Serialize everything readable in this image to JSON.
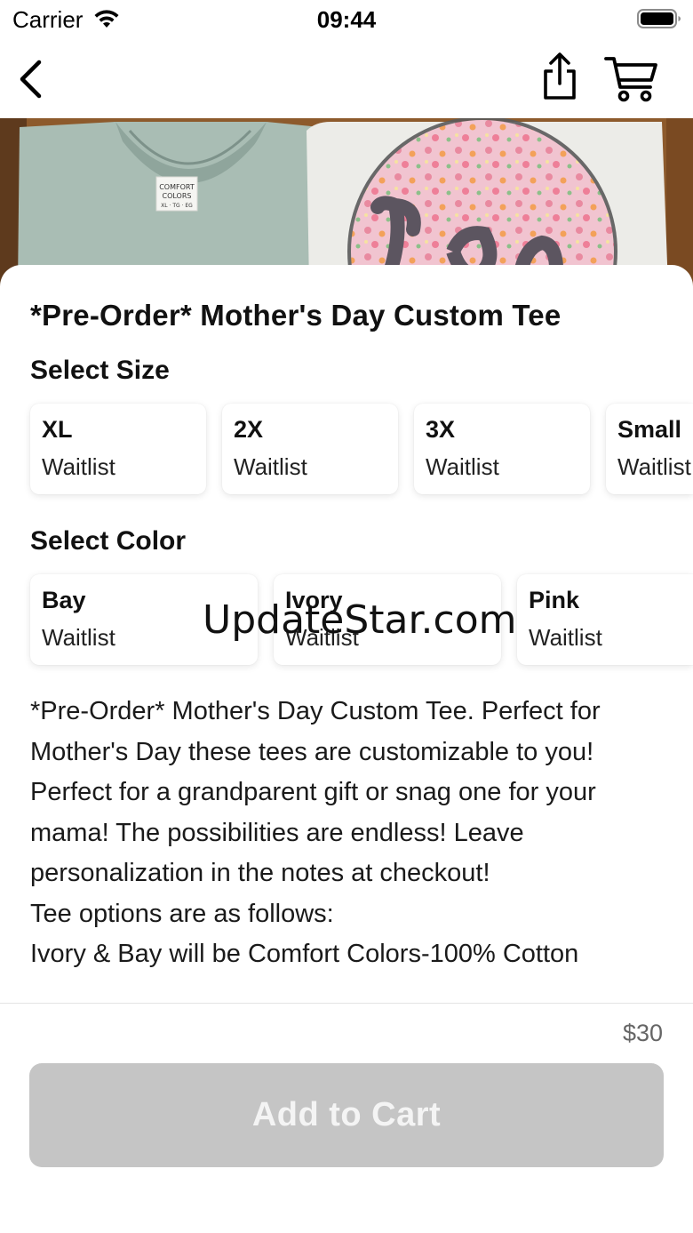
{
  "status_bar": {
    "carrier": "Carrier",
    "time": "09:44"
  },
  "nav": {
    "back_icon": "chevron-left-icon",
    "share_icon": "share-icon",
    "cart_icon": "cart-icon"
  },
  "product": {
    "title": "*Pre-Order* Mother's Day Custom Tee",
    "price": "$30"
  },
  "size_section": {
    "title": "Select Size",
    "options": [
      {
        "name": "XL",
        "status": "Waitlist"
      },
      {
        "name": "2X",
        "status": "Waitlist"
      },
      {
        "name": "3X",
        "status": "Waitlist"
      },
      {
        "name": "Small",
        "status": "Waitlist"
      }
    ]
  },
  "color_section": {
    "title": "Select Color",
    "options": [
      {
        "name": "Bay",
        "status": "Waitlist"
      },
      {
        "name": "Ivory",
        "status": "Waitlist"
      },
      {
        "name": "Pink",
        "status": "Waitlist"
      }
    ]
  },
  "description": "*Pre-Order* Mother's Day Custom Tee. Perfect for Mother's Day these tees are customizable to you! Perfect for a grandparent gift or snag one for your mama! The possibilities are endless! Leave personalization in the notes at checkout!\nTee options are as follows:\nIvory & Bay will be Comfort Colors-100% Cotton",
  "actions": {
    "add_to_cart": "Add to Cart"
  },
  "watermark": "UpdateStar.com",
  "colors": {
    "button_disabled": "#c5c5c5",
    "shirt_sage": "#a9bdb4",
    "shirt_ivory": "#eeeeea",
    "table_wood": "#8a5a2e"
  }
}
